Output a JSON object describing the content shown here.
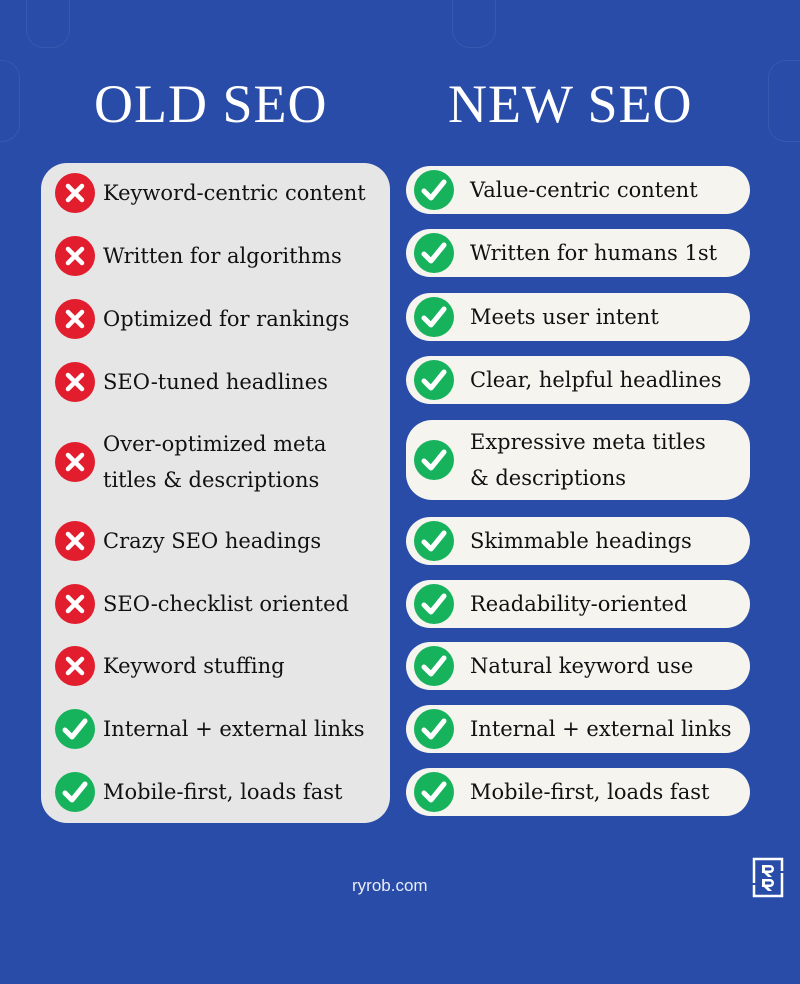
{
  "colors": {
    "background": "#284ca8",
    "old_panel": "#e6e6e6",
    "new_pill": "#f6f4ef",
    "cross": "#e11d2e",
    "check": "#16b35c"
  },
  "headers": {
    "old": "OLD SEO",
    "new": "NEW SEO"
  },
  "old_items": [
    {
      "icon": "cross-icon",
      "label": "Keyword-centric content"
    },
    {
      "icon": "cross-icon",
      "label": "Written for algorithms"
    },
    {
      "icon": "cross-icon",
      "label": "Optimized for rankings"
    },
    {
      "icon": "cross-icon",
      "label": "SEO-tuned headlines"
    },
    {
      "icon": "cross-icon",
      "label": "Over-optimized meta\ntitles & descriptions"
    },
    {
      "icon": "cross-icon",
      "label": "Crazy SEO headings"
    },
    {
      "icon": "cross-icon",
      "label": "SEO-checklist oriented"
    },
    {
      "icon": "cross-icon",
      "label": "Keyword stuffing"
    },
    {
      "icon": "check-icon",
      "label": "Internal + external links"
    },
    {
      "icon": "check-icon",
      "label": "Mobile-first, loads fast"
    }
  ],
  "new_items": [
    {
      "icon": "check-icon",
      "label": "Value-centric content"
    },
    {
      "icon": "check-icon",
      "label": "Written for humans 1st"
    },
    {
      "icon": "check-icon",
      "label": "Meets user intent"
    },
    {
      "icon": "check-icon",
      "label": "Clear, helpful headlines"
    },
    {
      "icon": "check-icon",
      "label": "Expressive meta titles\n& descriptions"
    },
    {
      "icon": "check-icon",
      "label": "Skimmable headings"
    },
    {
      "icon": "check-icon",
      "label": "Readability-oriented"
    },
    {
      "icon": "check-icon",
      "label": "Natural keyword use"
    },
    {
      "icon": "check-icon",
      "label": "Internal + external links"
    },
    {
      "icon": "check-icon",
      "label": "Mobile-first, loads fast"
    }
  ],
  "footer": {
    "site": "ryrob.com",
    "logo": "rr-logo-icon"
  }
}
